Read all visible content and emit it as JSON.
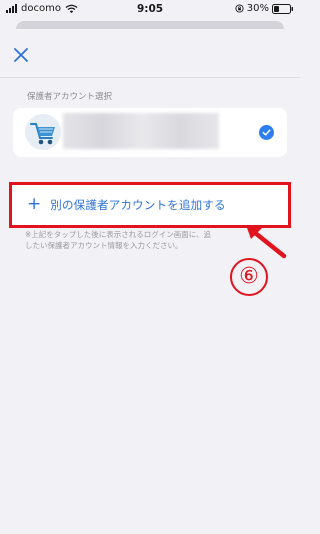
{
  "status_bar": {
    "carrier": "docomo",
    "time": "9:05",
    "battery": "30%"
  },
  "header": {
    "close_icon": "close-icon"
  },
  "section": {
    "label": "保護者アカウント選択"
  },
  "account": {
    "avatar_icon": "cart-icon",
    "selected": true
  },
  "add_account": {
    "icon": "plus-icon",
    "label": "別の保護者アカウントを追加する"
  },
  "note": {
    "line1": "※上記をタップした後に表示されるログイン画面に、追",
    "line2": "したい保護者アカウント情報を入力ください。"
  },
  "annotation": {
    "step": "⑥",
    "color": "#e1131d"
  },
  "colors": {
    "accent": "#2d73d6",
    "background": "#f1f1f6",
    "highlight": "#e1131d"
  }
}
